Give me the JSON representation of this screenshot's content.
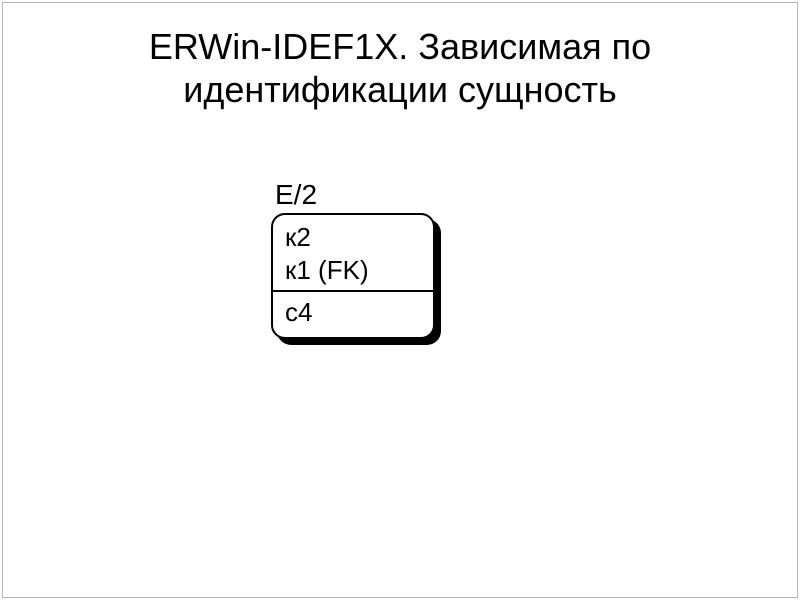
{
  "slide": {
    "title_line1": "ERWin-IDEF1X. Зависимая по",
    "title_line2": "идентификации сущность"
  },
  "entity": {
    "name": "E/2",
    "key_attrs": [
      "к2",
      "к1 (FK)"
    ],
    "non_key_attrs": [
      "с4"
    ]
  }
}
